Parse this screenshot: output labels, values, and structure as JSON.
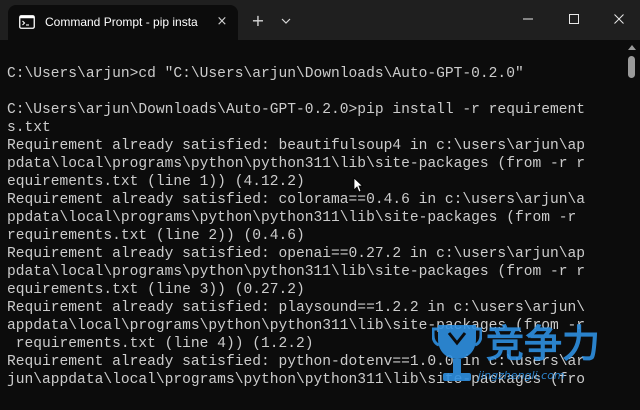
{
  "window": {
    "tab_title": "Command Prompt - pip  insta",
    "tab_icon": "terminal-icon",
    "tab_close": "×",
    "new_tab": "+",
    "tab_dropdown": "⌄",
    "controls": [
      "minimize-icon",
      "maximize-icon",
      "close-icon"
    ]
  },
  "terminal": {
    "lines": [
      "",
      "C:\\Users\\arjun>cd \"C:\\Users\\arjun\\Downloads\\Auto-GPT-0.2.0\"",
      "",
      "C:\\Users\\arjun\\Downloads\\Auto-GPT-0.2.0>pip install -r requirement",
      "s.txt",
      "Requirement already satisfied: beautifulsoup4 in c:\\users\\arjun\\ap",
      "pdata\\local\\programs\\python\\python311\\lib\\site-packages (from -r r",
      "equirements.txt (line 1)) (4.12.2)",
      "Requirement already satisfied: colorama==0.4.6 in c:\\users\\arjun\\a",
      "ppdata\\local\\programs\\python\\python311\\lib\\site-packages (from -r",
      "requirements.txt (line 2)) (0.4.6)",
      "Requirement already satisfied: openai==0.27.2 in c:\\users\\arjun\\ap",
      "pdata\\local\\programs\\python\\python311\\lib\\site-packages (from -r r",
      "equirements.txt (line 3)) (0.27.2)",
      "Requirement already satisfied: playsound==1.2.2 in c:\\users\\arjun\\",
      "appdata\\local\\programs\\python\\python311\\lib\\site-packages (from -r",
      " requirements.txt (line 4)) (1.2.2)",
      "Requirement already satisfied: python-dotenv==1.0.0 in c:\\users\\ar",
      "jun\\appdata\\local\\programs\\python\\python311\\lib\\site-packages (fro"
    ]
  },
  "watermark": {
    "text": "竞争力",
    "url": "jingzhengli.com",
    "logo": "trophy-logo",
    "color": "#2e8fe0"
  },
  "colors": {
    "titlebar": "#1f1f1f",
    "background": "#0c0c0c",
    "text": "#cccccc"
  }
}
